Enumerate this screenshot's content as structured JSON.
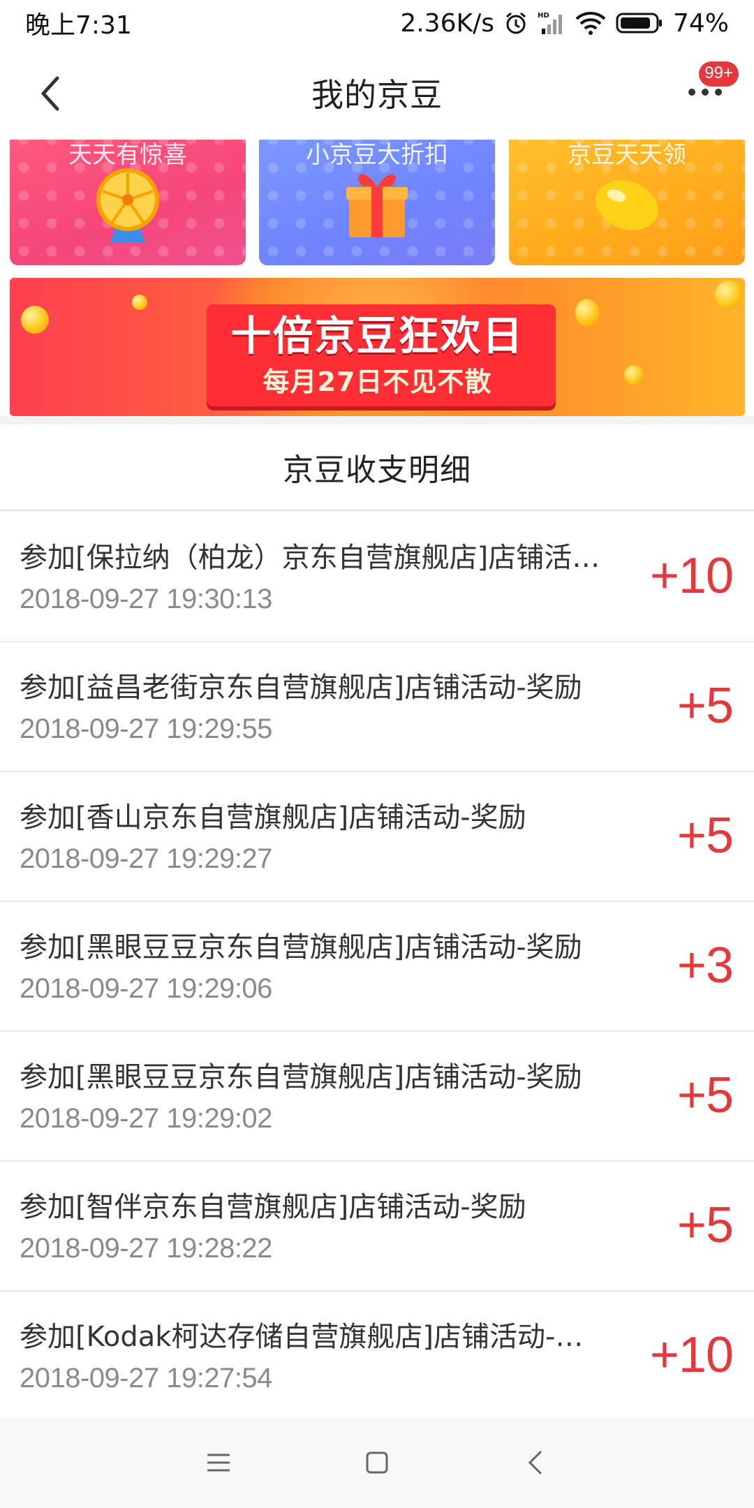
{
  "status_bar": {
    "time": "晚上7:31",
    "network_speed": "2.36K/s",
    "battery": "74%",
    "icons": [
      "alarm-icon",
      "hd-signal-icon",
      "wifi-icon",
      "battery-icon"
    ]
  },
  "nav": {
    "title": "我的京豆",
    "badge": "99+",
    "back_icon": "chevron-left-icon",
    "more_icon": "more-dots-icon"
  },
  "promos": [
    {
      "title": "天天有惊喜",
      "icon": "wheel-icon"
    },
    {
      "title": "小京豆大折扣",
      "icon": "gift-box-icon"
    },
    {
      "title": "京豆天天领",
      "icon": "bean-icon"
    }
  ],
  "banner": {
    "title": "十倍京豆狂欢日",
    "subtitle": "每月27日不见不散"
  },
  "section": {
    "title": "京豆收支明细"
  },
  "transactions": [
    {
      "desc": "参加[保拉纳（柏龙）京东自营旗舰店]店铺活…",
      "time": "2018-09-27 19:30:13",
      "amount": "+10"
    },
    {
      "desc": "参加[益昌老街京东自营旗舰店]店铺活动-奖励",
      "time": "2018-09-27 19:29:55",
      "amount": "+5"
    },
    {
      "desc": "参加[香山京东自营旗舰店]店铺活动-奖励",
      "time": "2018-09-27 19:29:27",
      "amount": "+5"
    },
    {
      "desc": "参加[黑眼豆豆京东自营旗舰店]店铺活动-奖励",
      "time": "2018-09-27 19:29:06",
      "amount": "+3"
    },
    {
      "desc": "参加[黑眼豆豆京东自营旗舰店]店铺活动-奖励",
      "time": "2018-09-27 19:29:02",
      "amount": "+5"
    },
    {
      "desc": "参加[智伴京东自营旗舰店]店铺活动-奖励",
      "time": "2018-09-27 19:28:22",
      "amount": "+5"
    },
    {
      "desc": "参加[Kodak柯达存储自营旗舰店]店铺活动-…",
      "time": "2018-09-27 19:27:54",
      "amount": "+10"
    }
  ],
  "colors": {
    "accent_red": "#e4393c",
    "text_primary": "#333333",
    "text_secondary": "#8a8a8a"
  },
  "system_nav": [
    "menu-icon",
    "home-square-icon",
    "back-icon"
  ]
}
